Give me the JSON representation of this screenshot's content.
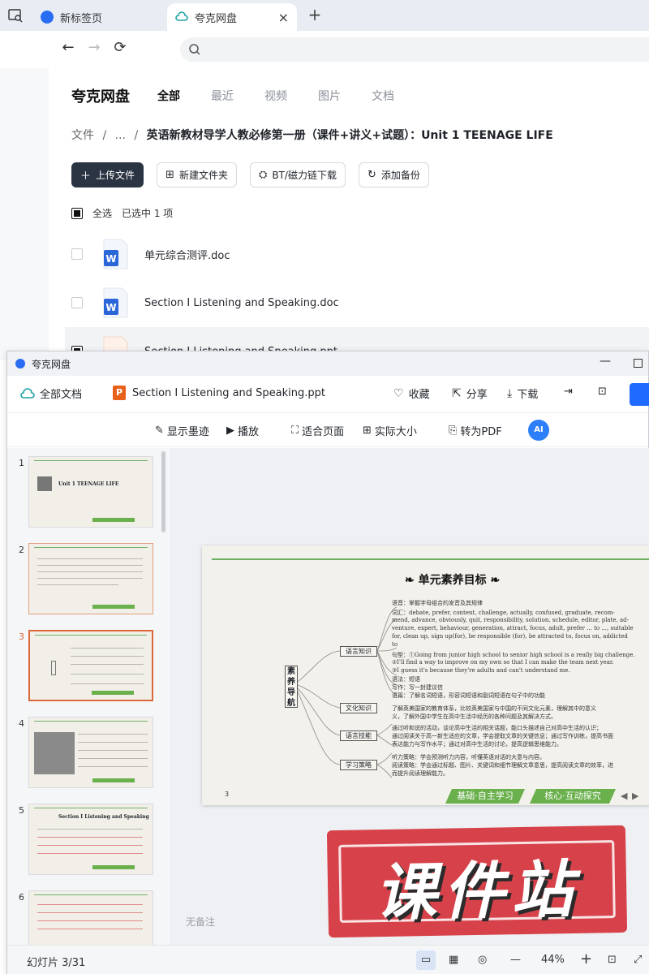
{
  "browser": {
    "tabs": [
      {
        "label": "新标签页",
        "active": false
      },
      {
        "label": "夸克网盘",
        "active": true
      }
    ],
    "new_tab": "+",
    "close": "×"
  },
  "pan": {
    "logo": "夸克网盘",
    "nav": [
      "全部",
      "最近",
      "视频",
      "图片",
      "文档"
    ],
    "breadcrumb": {
      "root": "文件",
      "sep": "/",
      "ellipsis": "...",
      "current": "英语新教材导学人教必修第一册（课件+讲义+试题）：Unit 1 TEENAGE LIFE"
    },
    "actions": [
      {
        "label": "上传文件",
        "icon": "plus-icon"
      },
      {
        "label": "新建文件夹",
        "icon": "folder-plus-icon"
      },
      {
        "label": "BT/磁力链下载",
        "icon": "bt-icon"
      },
      {
        "label": "添加备份",
        "icon": "sync-icon"
      }
    ],
    "select_all": "全选",
    "selected_text": "已选中  1  项",
    "files": [
      {
        "name": "单元综合测评.doc",
        "type": "word"
      },
      {
        "name": "Section Ⅰ Listening and Speaking.doc",
        "type": "word"
      },
      {
        "name": "Section Ⅰ Listening and Speaking.ppt",
        "type": "ppt"
      }
    ]
  },
  "viewer": {
    "window_title": "夸克网盘",
    "all_docs": "全部文档",
    "file_badge": "P",
    "file_name": "Section Ⅰ Listening and Speaking.ppt",
    "top_actions": [
      {
        "label": "收藏",
        "icon": "heart-icon"
      },
      {
        "label": "分享",
        "icon": "share-icon"
      },
      {
        "label": "下载",
        "icon": "download-icon"
      }
    ],
    "sub_tools": [
      {
        "label": "显示墨迹",
        "icon": "ink-icon"
      },
      {
        "label": "播放",
        "icon": "play-icon"
      },
      {
        "label": "适合页面",
        "icon": "fit-page-icon"
      },
      {
        "label": "实际大小",
        "icon": "actual-size-icon"
      },
      {
        "label": "转为PDF",
        "icon": "pdf-icon"
      }
    ],
    "ai_label": "AI",
    "thumb_numbers": [
      "1",
      "2",
      "3",
      "4",
      "5",
      "6"
    ],
    "thumb1_title": "Unit 1  TEENAGE LIFE",
    "thumb5_title": "Section Ⅰ   Listening and Speaking",
    "notes_placeholder": "无备注",
    "status_slide": "幻灯片 3/31",
    "zoom": "44%",
    "zoom_minus": "—",
    "zoom_plus": "+"
  },
  "slide": {
    "title": "单元素养目标",
    "center": [
      "素",
      "养",
      "导",
      "航"
    ],
    "branches": [
      "语言知识",
      "文化知识",
      "语言技能",
      "学习策略"
    ],
    "texts": [
      "语音：掌握字母组合的发音及其规律",
      "词汇：debate, prefer, content, challenge, actually, confused, graduate, recom-",
      "mend, advance, obviously, quit, responsibility, solution, schedule, editor, plate, ad-",
      "venture, expert, behaviour, generation, attract, focus, adult, prefer ... to ..., suitable",
      "for, clean up, sign up(for), be responsible (for), be attracted to, focus on, addicted",
      "to",
      "句型：①Going from junior high school to senior high school is a really big challenge.",
      "②I'll find a way to improve on my own so that I can make the team next year.",
      "③I guess it's because they're adults and can't understand me.",
      "语法：短语",
      "写作：写一封建议信",
      "语篇：了解名词短语，形容词短语和副词短语在句子中的功能",
      "了解英美国家的教育体系，比较英美国家与中国的不同文化元素，理解其中的意义",
      "义，了解外国中学生在高中生活中经历的各种问题及其解决方式。",
      "通过听和说的活动，谈论高中生活的相关话题，能口头描述自己对高中生活的认识；",
      "通过阅读关于高一新生适应的文章，学会提取文章的关键信息；通过写作训练，提高书面",
      "表达能力与写作水平；通过对高中生活的讨论，提高逻辑思维能力。",
      "听力策略：学会预测听力内容，听懂英语对话的大意与内容。",
      "阅读策略：学会通过标题、图片、关键词和细节理解文章意思，提高阅读文章的效率，进",
      "而提升阅读理解能力。"
    ],
    "page_num": "3",
    "btn_basic": "基础·自主学习",
    "btn_core": "核心·互动探究"
  },
  "watermark": "课件站",
  "colors": {
    "accent_blue": "#1f6bff",
    "ppt_orange": "#e8611b",
    "slide_green": "#6ab04c",
    "stamp_red": "#d7424a"
  }
}
